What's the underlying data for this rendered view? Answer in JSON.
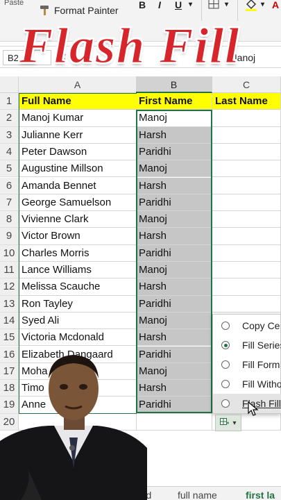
{
  "ribbon": {
    "paste_label": "Paste",
    "format_painter_label": "Format Painter",
    "bold_label": "B",
    "italic_label": "I",
    "underline_label": "U",
    "font_color_label": "A"
  },
  "formula_bar": {
    "name_box": "B2",
    "value": "Manoj"
  },
  "overlay_title": "Flash  Fill",
  "columns": [
    "A",
    "B",
    "C"
  ],
  "headers": [
    "Full Name",
    "First Name",
    "Last Name"
  ],
  "rows": [
    {
      "num": "1"
    },
    {
      "num": "2",
      "full": "Manoj Kumar",
      "first": "Manoj"
    },
    {
      "num": "3",
      "full": "Julianne Kerr",
      "first": "Harsh"
    },
    {
      "num": "4",
      "full": "Peter Dawson",
      "first": "Paridhi"
    },
    {
      "num": "5",
      "full": "Augustine Millson",
      "first": "Manoj"
    },
    {
      "num": "6",
      "full": "Amanda Bennet",
      "first": "Harsh"
    },
    {
      "num": "7",
      "full": "George Samuelson",
      "first": "Paridhi"
    },
    {
      "num": "8",
      "full": "Vivienne Clark",
      "first": "Manoj"
    },
    {
      "num": "9",
      "full": "Victor Brown",
      "first": "Harsh"
    },
    {
      "num": "10",
      "full": "Charles Morris",
      "first": "Paridhi"
    },
    {
      "num": "11",
      "full": "Lance Williams",
      "first": "Manoj"
    },
    {
      "num": "12",
      "full": "Melissa Scauche",
      "first": "Harsh"
    },
    {
      "num": "13",
      "full": "Ron Tayley",
      "first": "Paridhi"
    },
    {
      "num": "14",
      "full": "Syed Ali",
      "first": "Manoj"
    },
    {
      "num": "15",
      "full": "Victoria Mcdonald",
      "first": "Harsh"
    },
    {
      "num": "16",
      "full": "Elizabeth Dangaard",
      "first": "Paridhi"
    },
    {
      "num": "17",
      "full": "Moha",
      "first": "Manoj"
    },
    {
      "num": "18",
      "full": "Timo",
      "first": "Harsh"
    },
    {
      "num": "19",
      "full": "Anne",
      "first": "Paridhi"
    },
    {
      "num": "20"
    }
  ],
  "autofill_menu": {
    "items": [
      {
        "label": "Copy Ce",
        "selected": false
      },
      {
        "label": "Fill Series",
        "selected": true
      },
      {
        "label": "Fill Form",
        "selected": false
      },
      {
        "label": "Fill Witho",
        "selected": false
      },
      {
        "label": "Flash Fill",
        "selected": false
      }
    ]
  },
  "sheet_tabs": [
    "red",
    "full name",
    "first la"
  ],
  "colors": {
    "accent": "#217346",
    "header_fill": "#ffff00",
    "title_red": "#d7262b"
  }
}
